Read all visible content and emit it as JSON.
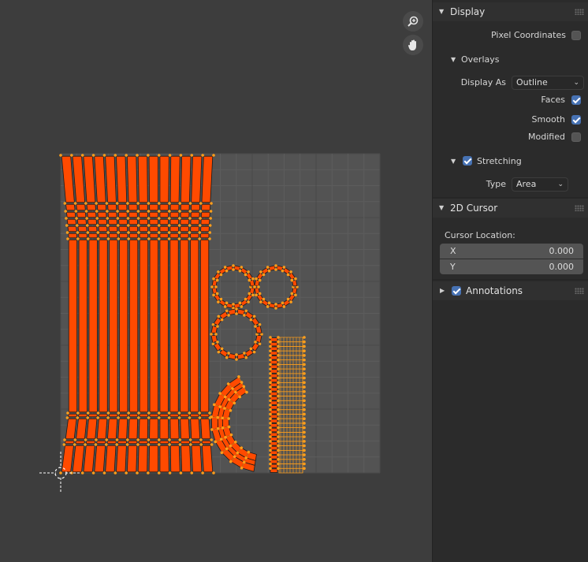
{
  "panel": {
    "display": {
      "title": "Display",
      "pixel_coordinates": {
        "label": "Pixel Coordinates",
        "checked": false
      },
      "overlays": {
        "title": "Overlays",
        "display_as": {
          "label": "Display As",
          "value": "Outline"
        },
        "faces": {
          "label": "Faces",
          "checked": true
        },
        "smooth": {
          "label": "Smooth",
          "checked": true
        },
        "modified": {
          "label": "Modified",
          "checked": false
        }
      },
      "stretching": {
        "title": "Stretching",
        "checked": true,
        "type": {
          "label": "Type",
          "value": "Area"
        }
      }
    },
    "cursor_2d": {
      "title": "2D Cursor",
      "location_label": "Cursor Location:",
      "x": {
        "label": "X",
        "value": "0.000"
      },
      "y": {
        "label": "Y",
        "value": "0.000"
      }
    },
    "annotations": {
      "title": "Annotations",
      "checked": true
    }
  },
  "viewport": {
    "zoom_icon": "zoom-icon",
    "pan_icon": "hand-pan-icon",
    "colors": {
      "face": "#ff4a00",
      "edge": "#ff9e1a",
      "grid_bg": "#535353",
      "bg": "#3d3d3d"
    }
  }
}
